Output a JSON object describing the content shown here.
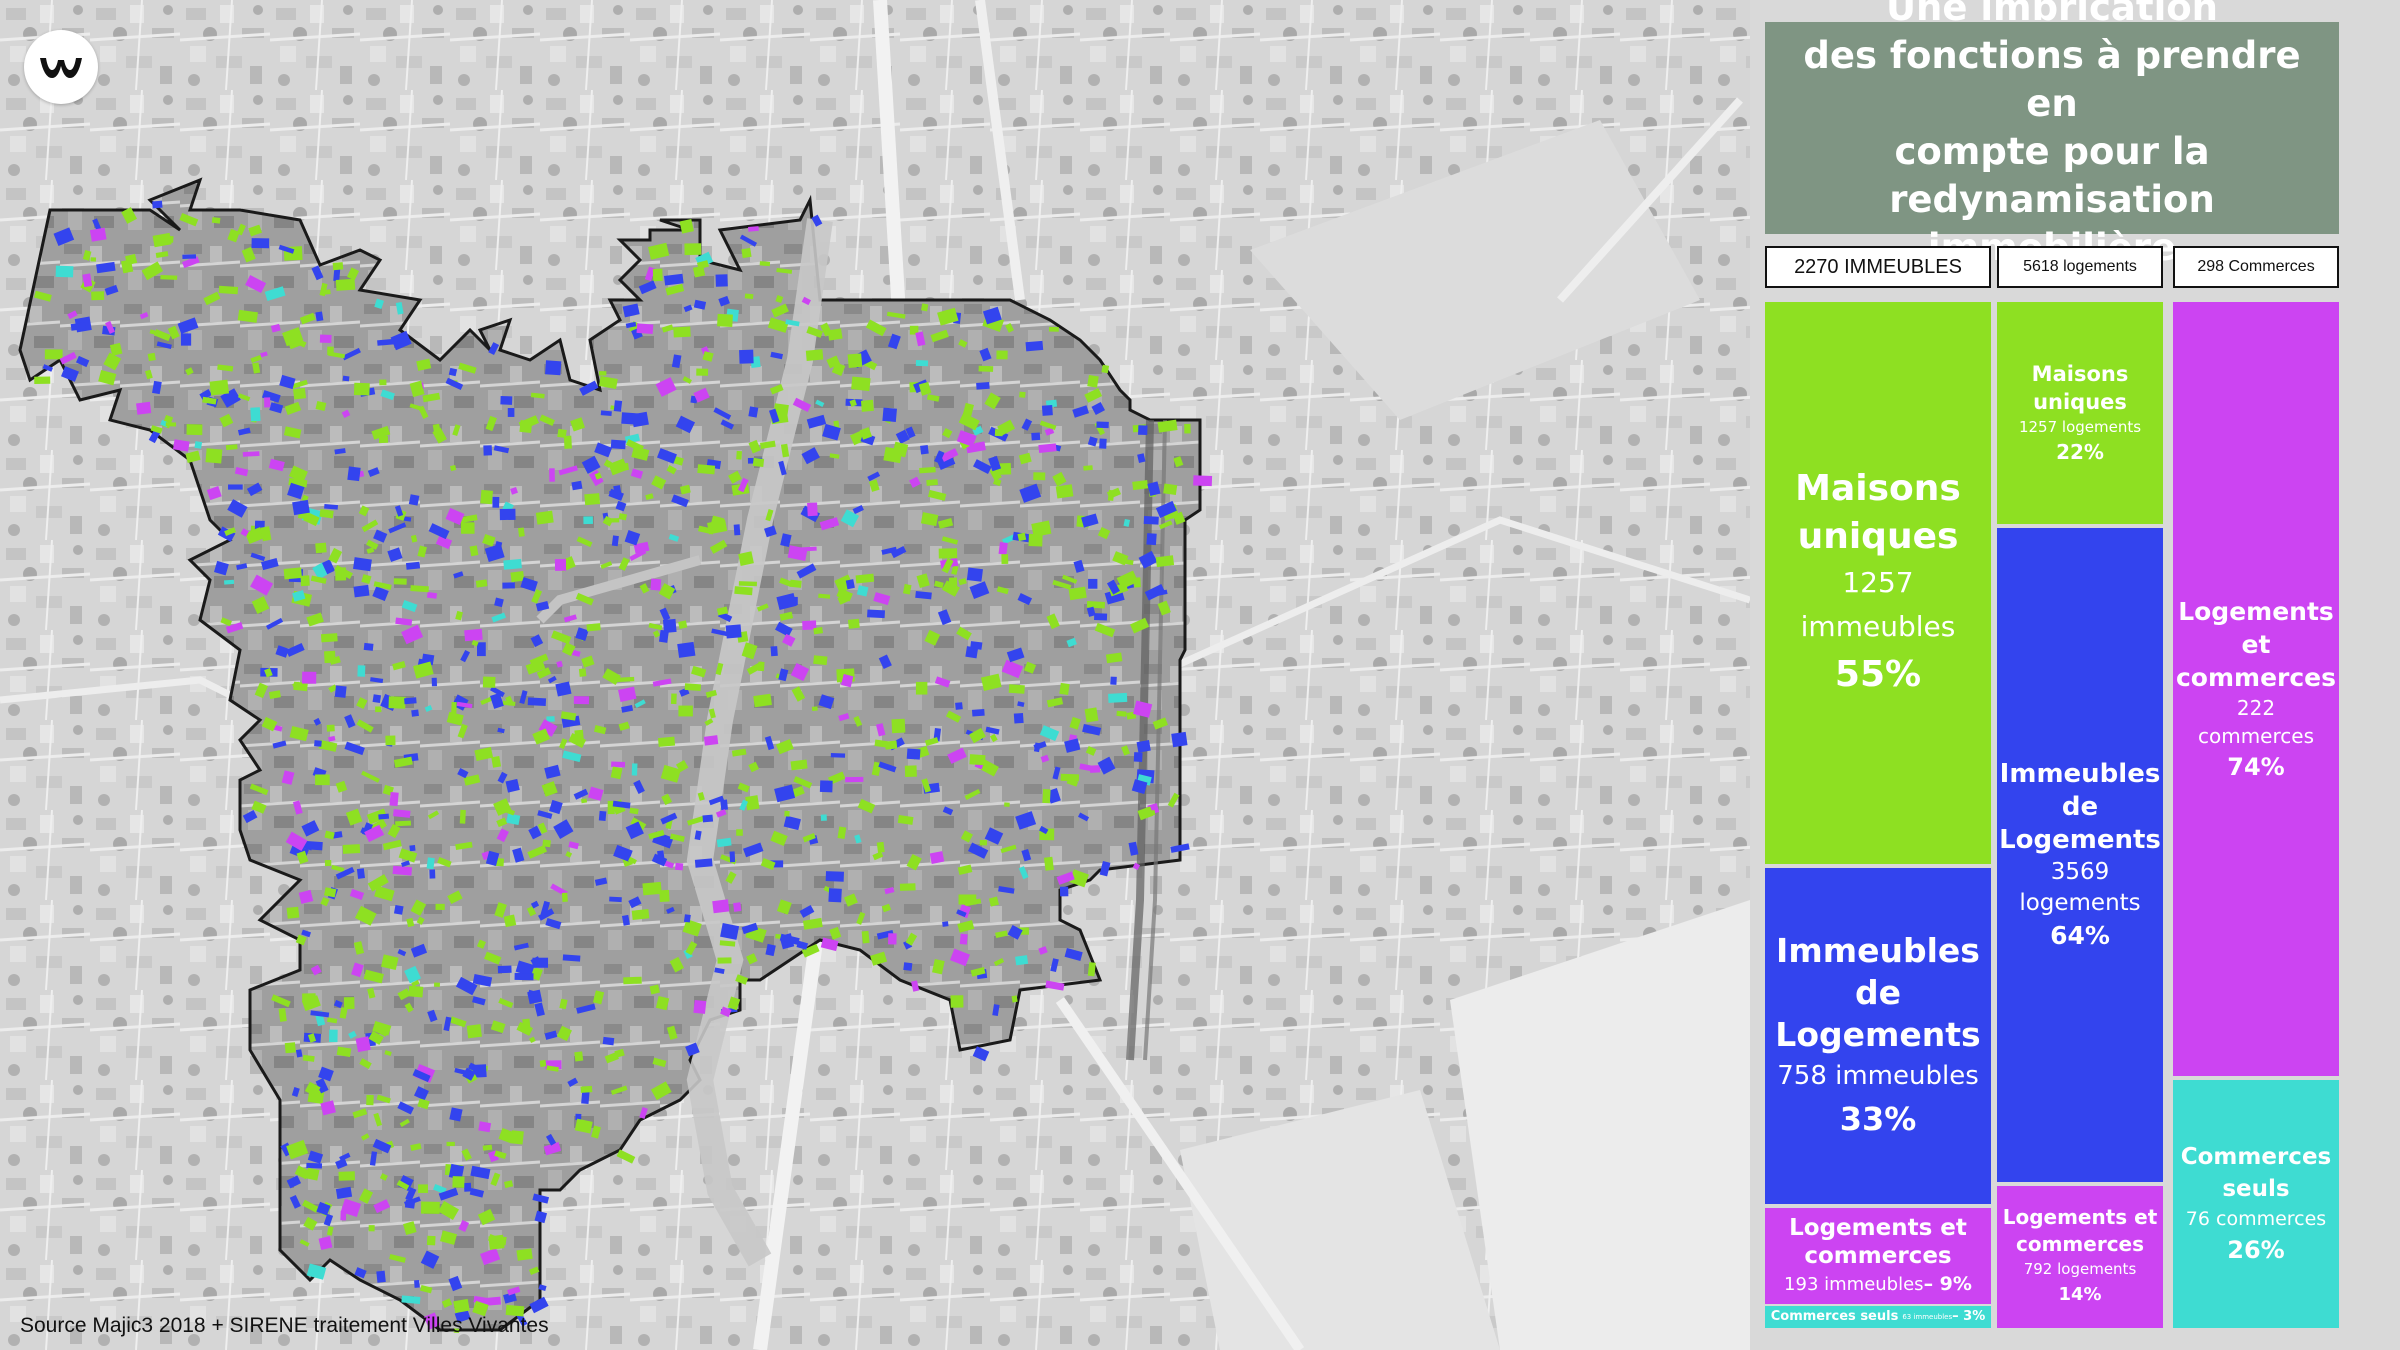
{
  "title": "Une imbrication\ndes fonctions à prendre en\ncompte pour la\nredynamisation immobilière",
  "source": "Source Majic3 2018 + SIRENE traitement Villes Vivantes",
  "colors": {
    "maisons_uniques": "#8ee022",
    "immeubles_logements": "#3344ee",
    "logements_commerces": "#cc44f2",
    "commerces_seuls": "#3edcd2",
    "title_bg": "#7f9583"
  },
  "columns": [
    {
      "header": "2270 IMMEUBLES",
      "blocks": [
        {
          "label": "Maisons\nuniques",
          "value": "1257\nimmeubles",
          "pct": "55%",
          "share": 0.55
        },
        {
          "label": "Immeubles\nde\nLogements",
          "value": "758 immeubles",
          "pct": "33%",
          "share": 0.33
        },
        {
          "label": "Logements et\ncommerces",
          "value": "193 immeubles",
          "pct": "– 9%",
          "share": 0.09
        },
        {
          "label": "Commerces seuls",
          "value": "63 immeubles",
          "pct": "– 3%",
          "share": 0.03
        }
      ]
    },
    {
      "header": "5618 logements",
      "blocks": [
        {
          "label": "Maisons\nuniques",
          "value": "1257 logements",
          "pct": "22%",
          "share": 0.22
        },
        {
          "label": "Immeubles\nde\nLogements",
          "value": "3569\nlogements",
          "pct": "64%",
          "share": 0.64
        },
        {
          "label": "Logements et\ncommerces",
          "value": "792 logements",
          "pct": "14%",
          "share": 0.14
        }
      ]
    },
    {
      "header": "298 Commerces",
      "blocks": [
        {
          "label": "Logements\net\ncommerces",
          "value": "222\ncommerces",
          "pct": "74%",
          "share": 0.74
        },
        {
          "label": "Commerces\nseuls",
          "value": "76 commerces",
          "pct": "26%",
          "share": 0.26
        }
      ]
    }
  ]
}
